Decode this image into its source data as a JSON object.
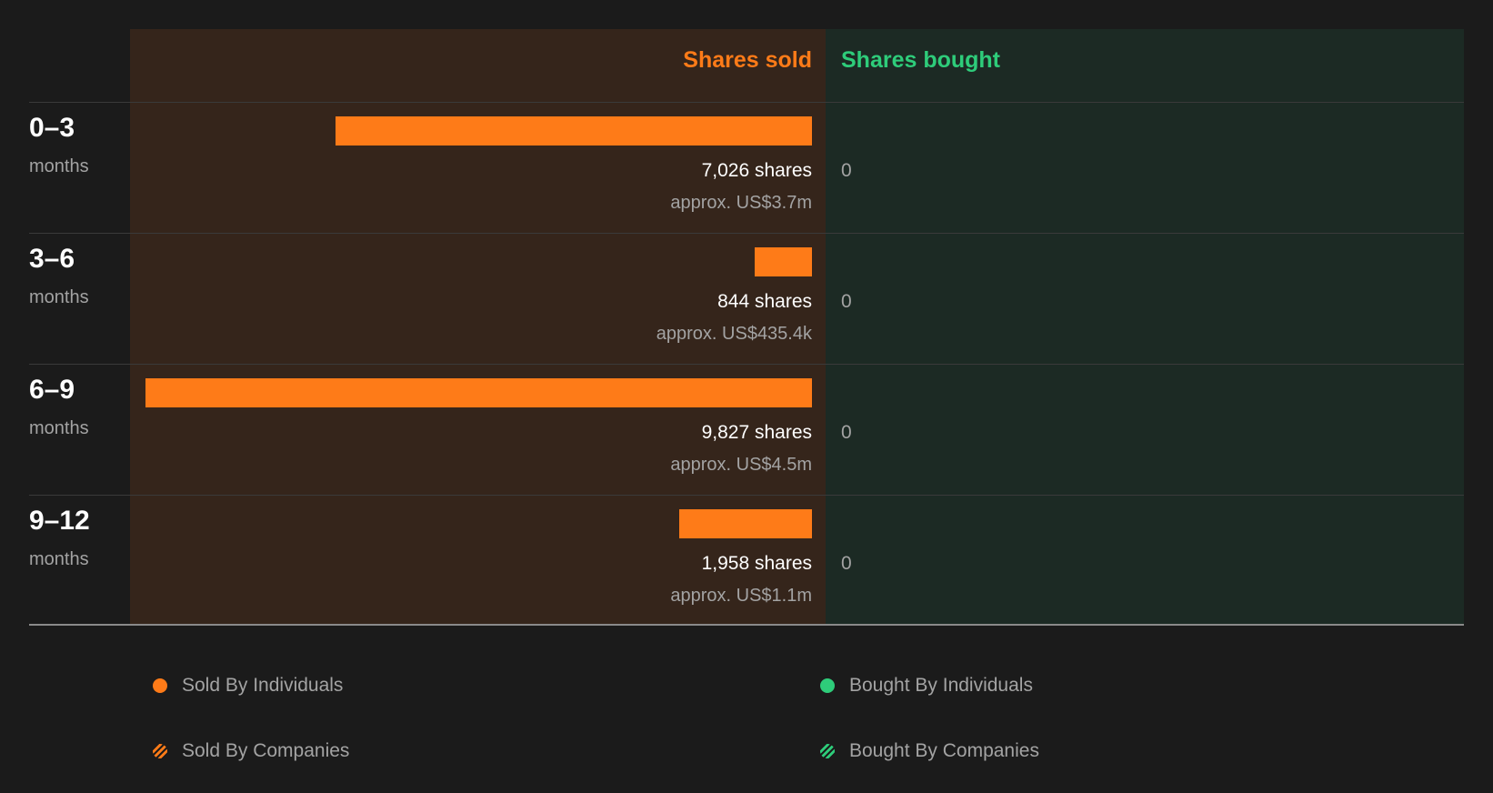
{
  "chart_data": {
    "type": "bar",
    "orientation": "horizontal",
    "header_sold": "Shares sold",
    "header_bought": "Shares bought",
    "unit": "months",
    "categories": [
      "0–3",
      "3–6",
      "6–9",
      "9–12"
    ],
    "series": [
      {
        "name": "Sold By Individuals",
        "color": "#fe7b18",
        "values": [
          7026,
          844,
          9827,
          1958
        ],
        "shares_labels": [
          "7,026 shares",
          "844 shares",
          "9,827 shares",
          "1,958 shares"
        ],
        "value_labels": [
          "approx. US$3.7m",
          "approx. US$435.4k",
          "approx. US$4.5m",
          "approx. US$1.1m"
        ]
      },
      {
        "name": "Bought By Individuals",
        "color": "#2ecc7a",
        "values": [
          0,
          0,
          0,
          0
        ],
        "labels": [
          "0",
          "0",
          "0",
          "0"
        ]
      }
    ],
    "legend": [
      {
        "label": "Sold By Individuals",
        "color": "#fe7b18",
        "style": "solid"
      },
      {
        "label": "Bought By Individuals",
        "color": "#2ecc7a",
        "style": "solid"
      },
      {
        "label": "Sold By Companies",
        "color": "#fe7b18",
        "style": "striped"
      },
      {
        "label": "Bought By Companies",
        "color": "#2ecc7a",
        "style": "striped"
      }
    ],
    "max_value": 9827,
    "colors": {
      "background": "#1b1b1b",
      "sold_panel": "#35251b",
      "bought_panel": "#1c2a24",
      "sold": "#fe7b18",
      "bought": "#2ecc7a"
    }
  }
}
